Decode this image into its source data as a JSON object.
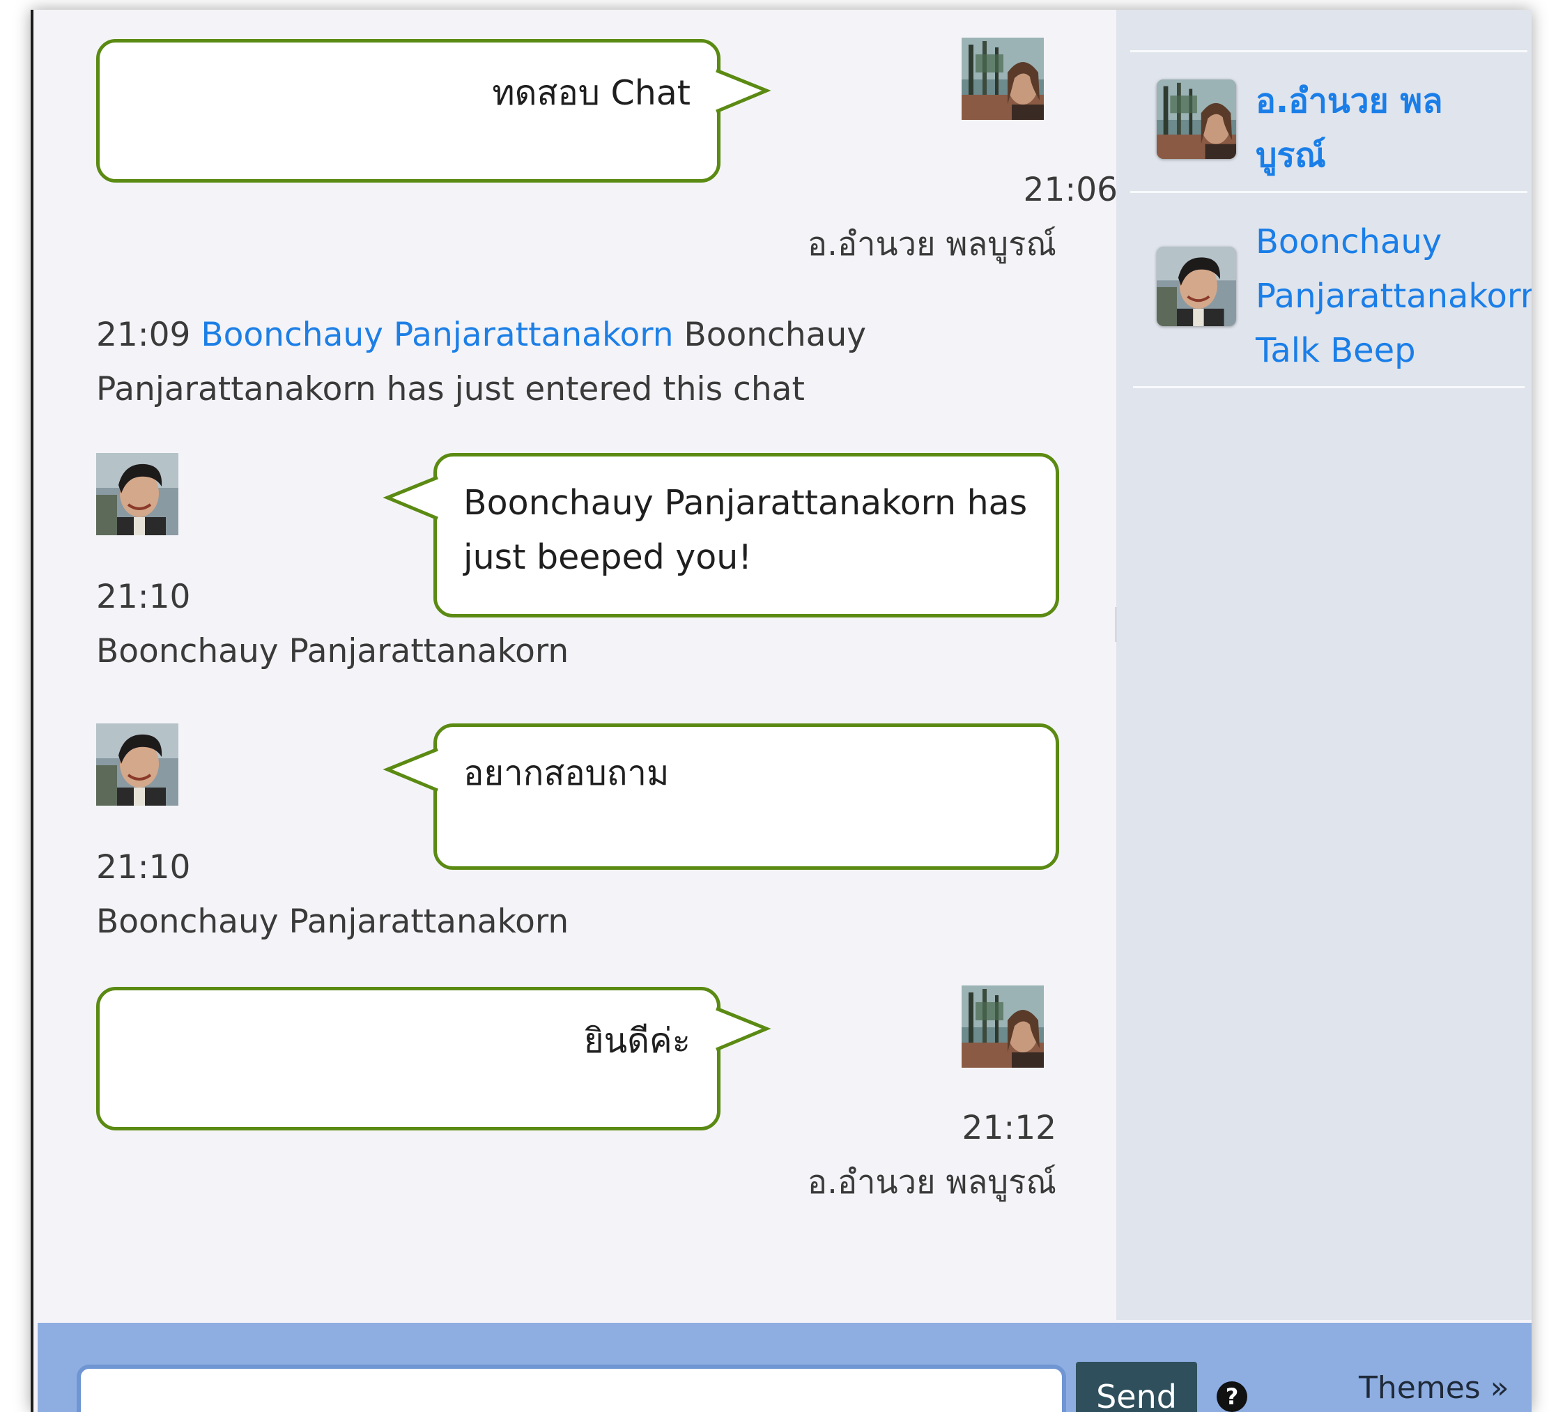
{
  "messages": [
    {
      "text": "ทดสอบ Chat",
      "time": "21:06",
      "sender": "อ.อำนวย พลบูรณ์"
    },
    {
      "time": "21:09",
      "link": "Boonchauy Panjarattanakorn",
      "line1": "Boonchauy",
      "line2": "Panjarattanakorn has just entered this chat"
    },
    {
      "text_line1": "Boonchauy Panjarattanakorn has",
      "text_line2": "just beeped you!",
      "time": "21:10",
      "sender": "Boonchauy Panjarattanakorn"
    },
    {
      "text": "อยากสอบถาม",
      "time": "21:10",
      "sender": "Boonchauy Panjarattanakorn"
    },
    {
      "text": "ยินดีค่ะ",
      "time": "21:12",
      "sender": "อ.อำนวย พลบูรณ์"
    }
  ],
  "users": [
    {
      "name_line1": "อ.อำนวย พล",
      "name_line2": "บูรณ์"
    },
    {
      "name_line1": "Boonchauy",
      "name_line2": "Panjarattanakorn",
      "talk": "Talk",
      "beep": "Beep"
    }
  ],
  "footer": {
    "input_value": "",
    "send_label": "Send",
    "help_icon": "question-circle-icon",
    "themes_label": "Themes »"
  },
  "colors": {
    "bubble_border": "#5b8a13",
    "link": "#1d7fe6",
    "footer_bg": "#8eaee2",
    "sidebar_bg": "#e0e4ec"
  }
}
